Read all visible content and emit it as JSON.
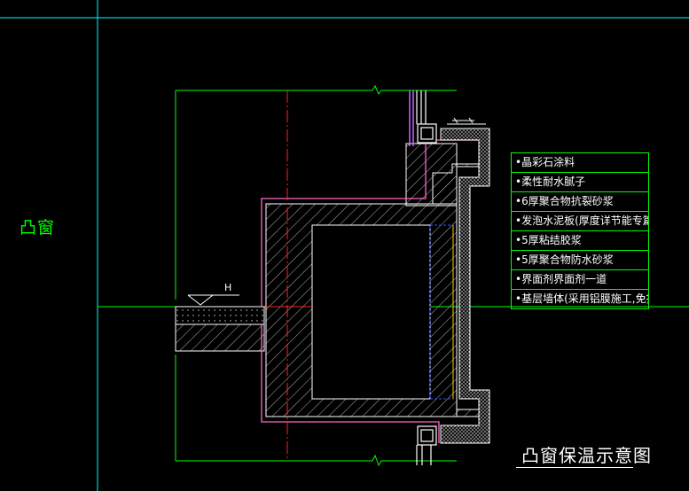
{
  "labels": {
    "side_label": "凸窗",
    "title": "凸窗保温示意图",
    "level_mark": "H"
  },
  "legend": {
    "items": [
      "•晶彩石涂料",
      "•柔性耐水腻子",
      "•6厚聚合物抗裂砂浆",
      "•发泡水泥板(厚度详节能专篇)",
      "•5厚粘结胶浆",
      "•5厚聚合物防水砂浆",
      "•界面剂界面剂一道",
      "•基层墙体(采用铝膜施工,免抹灰)"
    ]
  },
  "colors": {
    "background": "#000000",
    "grid_line": "#00ffff",
    "outline": "#00ff00",
    "insulation": "#ff66cc",
    "concrete_hatch": "#bbbbbb",
    "center_line": "#ff2222",
    "window_frame": "#ffffff",
    "glass": "#3355ff"
  }
}
